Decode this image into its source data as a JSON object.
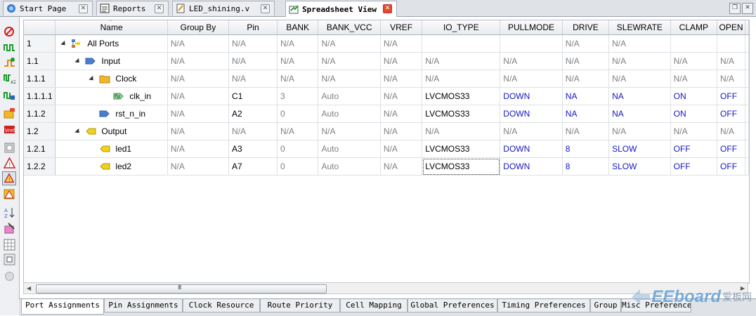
{
  "top_tabs": [
    {
      "label": "Start Page",
      "icon": "start-page-icon"
    },
    {
      "label": "Reports",
      "icon": "reports-icon"
    },
    {
      "label": "LED_shining.v",
      "icon": "verilog-file-icon"
    },
    {
      "label": "Spreadsheet View",
      "icon": "spreadsheet-icon",
      "active": true
    }
  ],
  "columns": [
    "Name",
    "Group By",
    "Pin",
    "BANK",
    "BANK_VCC",
    "VREF",
    "IO_TYPE",
    "PULLMODE",
    "DRIVE",
    "SLEWRATE",
    "CLAMP",
    "OPEN"
  ],
  "rows": [
    {
      "idx": "1",
      "name": "All Ports",
      "icon": "all-ports-icon",
      "level": 0,
      "expander": true,
      "cells": [
        "N/A",
        "N/A",
        "N/A",
        "N/A",
        "N/A",
        "",
        "",
        "N/A",
        "N/A",
        "",
        ""
      ]
    },
    {
      "idx": "1.1",
      "name": "Input",
      "icon": "input-port-icon",
      "level": 1,
      "expander": true,
      "cells": [
        "N/A",
        "N/A",
        "N/A",
        "N/A",
        "N/A",
        "N/A",
        "N/A",
        "N/A",
        "N/A",
        "N/A",
        "N/A"
      ]
    },
    {
      "idx": "1.1.1",
      "name": "Clock",
      "icon": "folder-icon",
      "level": 2,
      "expander": true,
      "cells": [
        "N/A",
        "N/A",
        "N/A",
        "N/A",
        "N/A",
        "N/A",
        "N/A",
        "N/A",
        "N/A",
        "N/A",
        "N/A"
      ]
    },
    {
      "idx": "1.1.1.1",
      "name": "clk_in",
      "icon": "clock-input-icon",
      "level": 3,
      "expander": false,
      "cells": [
        "N/A",
        "C1",
        "3",
        "Auto",
        "N/A",
        "LVCMOS33",
        "DOWN",
        "NA",
        "NA",
        "ON",
        "OFF"
      ]
    },
    {
      "idx": "1.1.2",
      "name": "rst_n_in",
      "icon": "input-port-icon",
      "level": 2,
      "expander": false,
      "cells": [
        "N/A",
        "A2",
        "0",
        "Auto",
        "N/A",
        "LVCMOS33",
        "DOWN",
        "NA",
        "NA",
        "ON",
        "OFF"
      ]
    },
    {
      "idx": "1.2",
      "name": "Output",
      "icon": "output-port-icon",
      "level": 1,
      "expander": true,
      "cells": [
        "N/A",
        "N/A",
        "N/A",
        "N/A",
        "N/A",
        "N/A",
        "N/A",
        "N/A",
        "N/A",
        "N/A",
        "N/A"
      ]
    },
    {
      "idx": "1.2.1",
      "name": "led1",
      "icon": "output-port-icon",
      "level": 2,
      "expander": false,
      "cells": [
        "N/A",
        "A3",
        "0",
        "Auto",
        "N/A",
        "LVCMOS33",
        "DOWN",
        "8",
        "SLOW",
        "OFF",
        "OFF"
      ]
    },
    {
      "idx": "1.2.2",
      "name": "led2",
      "icon": "output-port-icon",
      "level": 2,
      "expander": false,
      "cells": [
        "N/A",
        "A7",
        "0",
        "Auto",
        "N/A",
        "LVCMOS33",
        "DOWN",
        "8",
        "SLOW",
        "OFF",
        "OFF"
      ]
    }
  ],
  "scrollbar": {
    "grip": "III"
  },
  "bottom_tabs": [
    {
      "label": "Port Assignments",
      "active": true
    },
    {
      "label": "Pin Assignments"
    },
    {
      "label": "Clock Resource"
    },
    {
      "label": "Route Priority"
    },
    {
      "label": "Cell Mapping"
    },
    {
      "label": "Global Preferences"
    },
    {
      "label": "Timing Preferences"
    },
    {
      "label": "Group"
    },
    {
      "label": "Misc Preferences"
    }
  ],
  "watermark": {
    "brand": "EEboard",
    "text": "爱板网"
  },
  "colors": {
    "blue_value": "#1515c8",
    "na_value": "#808080",
    "input_icon": "#4a7fcf",
    "output_icon": "#f2d21c",
    "folder_icon": "#f1b728",
    "active_close": "#e24a2a"
  }
}
